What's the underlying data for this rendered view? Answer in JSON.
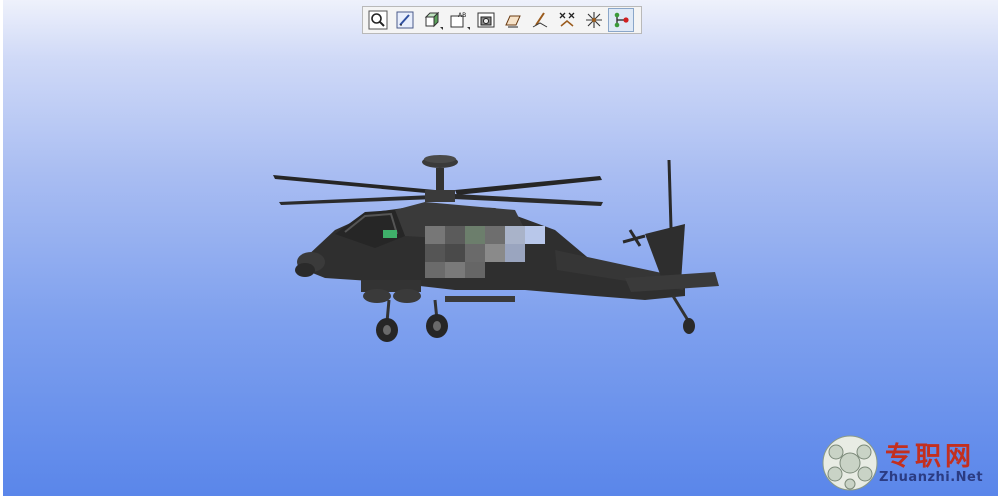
{
  "toolbar": {
    "tools": [
      {
        "icon": "zoom-icon"
      },
      {
        "icon": "edit-view-icon"
      },
      {
        "icon": "cube-view-icon"
      },
      {
        "icon": "text-annotation-icon"
      },
      {
        "icon": "camera-snapshot-icon"
      },
      {
        "icon": "measure-plane-icon"
      },
      {
        "icon": "section-pen-icon"
      },
      {
        "icon": "explode-x-icon"
      },
      {
        "icon": "explode-star-icon"
      },
      {
        "icon": "connect-nodes-icon",
        "active": true
      }
    ]
  },
  "watermark": {
    "title": "专职网",
    "url": "Zhuanzhi.Net"
  },
  "colors": {
    "background_top": "#eef1fb",
    "background_bottom": "#5a86ea",
    "model": "#2f2f2f",
    "watermark_red": "#c32f1f",
    "watermark_blue": "#2b3c83"
  }
}
